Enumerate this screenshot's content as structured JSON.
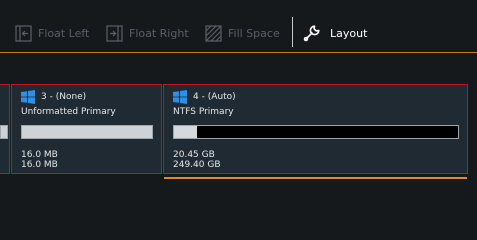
{
  "toolbar": {
    "float_left_label": "Float Left",
    "float_right_label": "Float Right",
    "fill_space_label": "Fill Space",
    "layout_label": "Layout",
    "active_item": "layout"
  },
  "colors": {
    "background": "#16191c",
    "card": "#1f2a32",
    "card_border": "#c01818",
    "accent": "#e08a2a",
    "windows_blue": "#2f8fe6"
  },
  "partitions": [
    {
      "header": "3 - (None)",
      "type": "Unformatted Primary",
      "used_fraction": 0,
      "size_line1": "16.0 MB",
      "size_line2": "16.0 MB",
      "icon": "windows-icon"
    },
    {
      "header": "4 - (Auto)",
      "type": "NTFS Primary",
      "used_fraction": 0.08,
      "size_line1": "20.45 GB",
      "size_line2": "249.40 GB",
      "icon": "windows-icon",
      "selected": true
    }
  ]
}
